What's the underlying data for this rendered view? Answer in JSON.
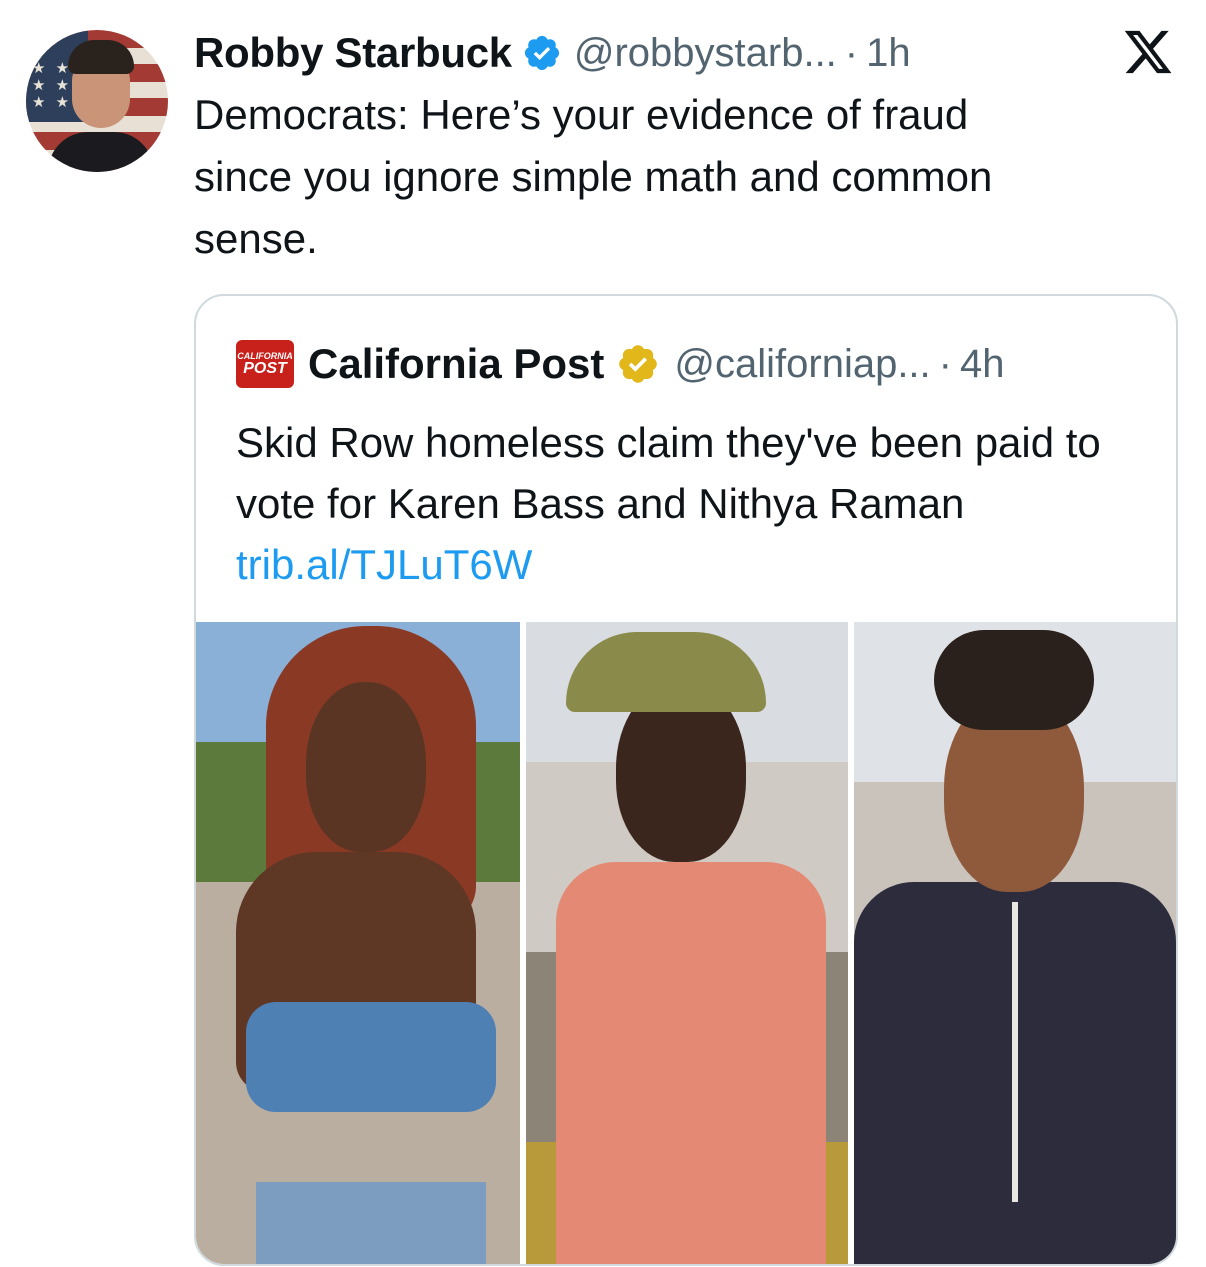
{
  "tweet": {
    "author_name": "Robby Starbuck",
    "handle": "@robbystarb...",
    "time": "1h",
    "separator": "·",
    "text": "Democrats: Here’s your evidence of fraud\nsince you ignore simple math and common\nsense."
  },
  "quoted": {
    "logo_line1": "CALIFORNIA",
    "logo_line2": "POST",
    "author_name": "California Post",
    "handle": "@californiap...",
    "time": "4h",
    "separator": "·",
    "text": "Skid Row homeless claim they've been paid to vote for Karen Bass and Nithya Raman",
    "link": "trib.al/TJLuT6W"
  },
  "icons": {
    "verified": "verified-badge-icon",
    "org_verified": "gold-verified-badge-icon",
    "platform": "x-logo-icon"
  },
  "colors": {
    "link": "#1d9bf0",
    "muted": "#536471",
    "verified_blue": "#1d9bf0",
    "verified_gold": "#e2b719"
  }
}
